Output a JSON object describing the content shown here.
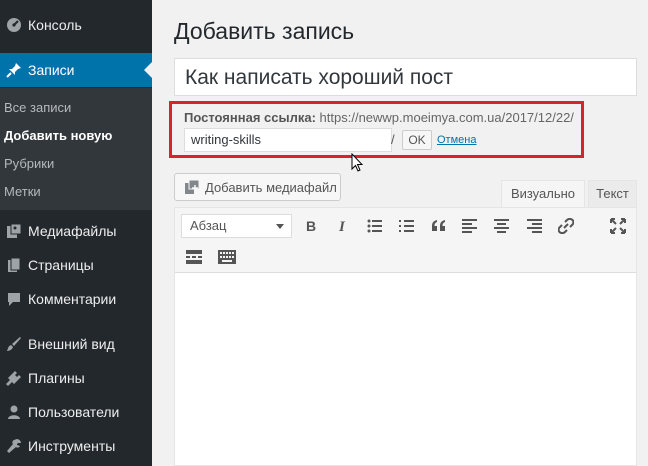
{
  "sidebar": {
    "items": [
      {
        "label": "Консоль",
        "icon": "dashboard-icon"
      },
      {
        "label": "Записи",
        "icon": "pin-icon"
      },
      {
        "label": "Медиафайлы",
        "icon": "media-icon"
      },
      {
        "label": "Страницы",
        "icon": "pages-icon"
      },
      {
        "label": "Комментарии",
        "icon": "comment-icon"
      },
      {
        "label": "Внешний вид",
        "icon": "brush-icon"
      },
      {
        "label": "Плагины",
        "icon": "plugin-icon"
      },
      {
        "label": "Пользователи",
        "icon": "user-icon"
      },
      {
        "label": "Инструменты",
        "icon": "wrench-icon"
      }
    ],
    "submenu": [
      {
        "label": "Все записи"
      },
      {
        "label": "Добавить новую"
      },
      {
        "label": "Рубрики"
      },
      {
        "label": "Метки"
      }
    ]
  },
  "main": {
    "page_title": "Добавить запись",
    "post_title": "Как написать хороший пост",
    "permalink": {
      "label": "Постоянная ссылка:",
      "base_url": "https://newwp.moeimya.com.ua/2017/12/22/",
      "slug": "writing-skills",
      "slash": "/",
      "ok_label": "OK",
      "cancel_label": "Отмена"
    },
    "media_button_label": "Добавить медиафайл",
    "tabs": {
      "visual": "Визуально",
      "text": "Текст"
    },
    "format_select": "Абзац"
  },
  "colors": {
    "sidebar_bg": "#23282d",
    "active_menu": "#0073aa",
    "highlight_border": "#d8232a"
  }
}
